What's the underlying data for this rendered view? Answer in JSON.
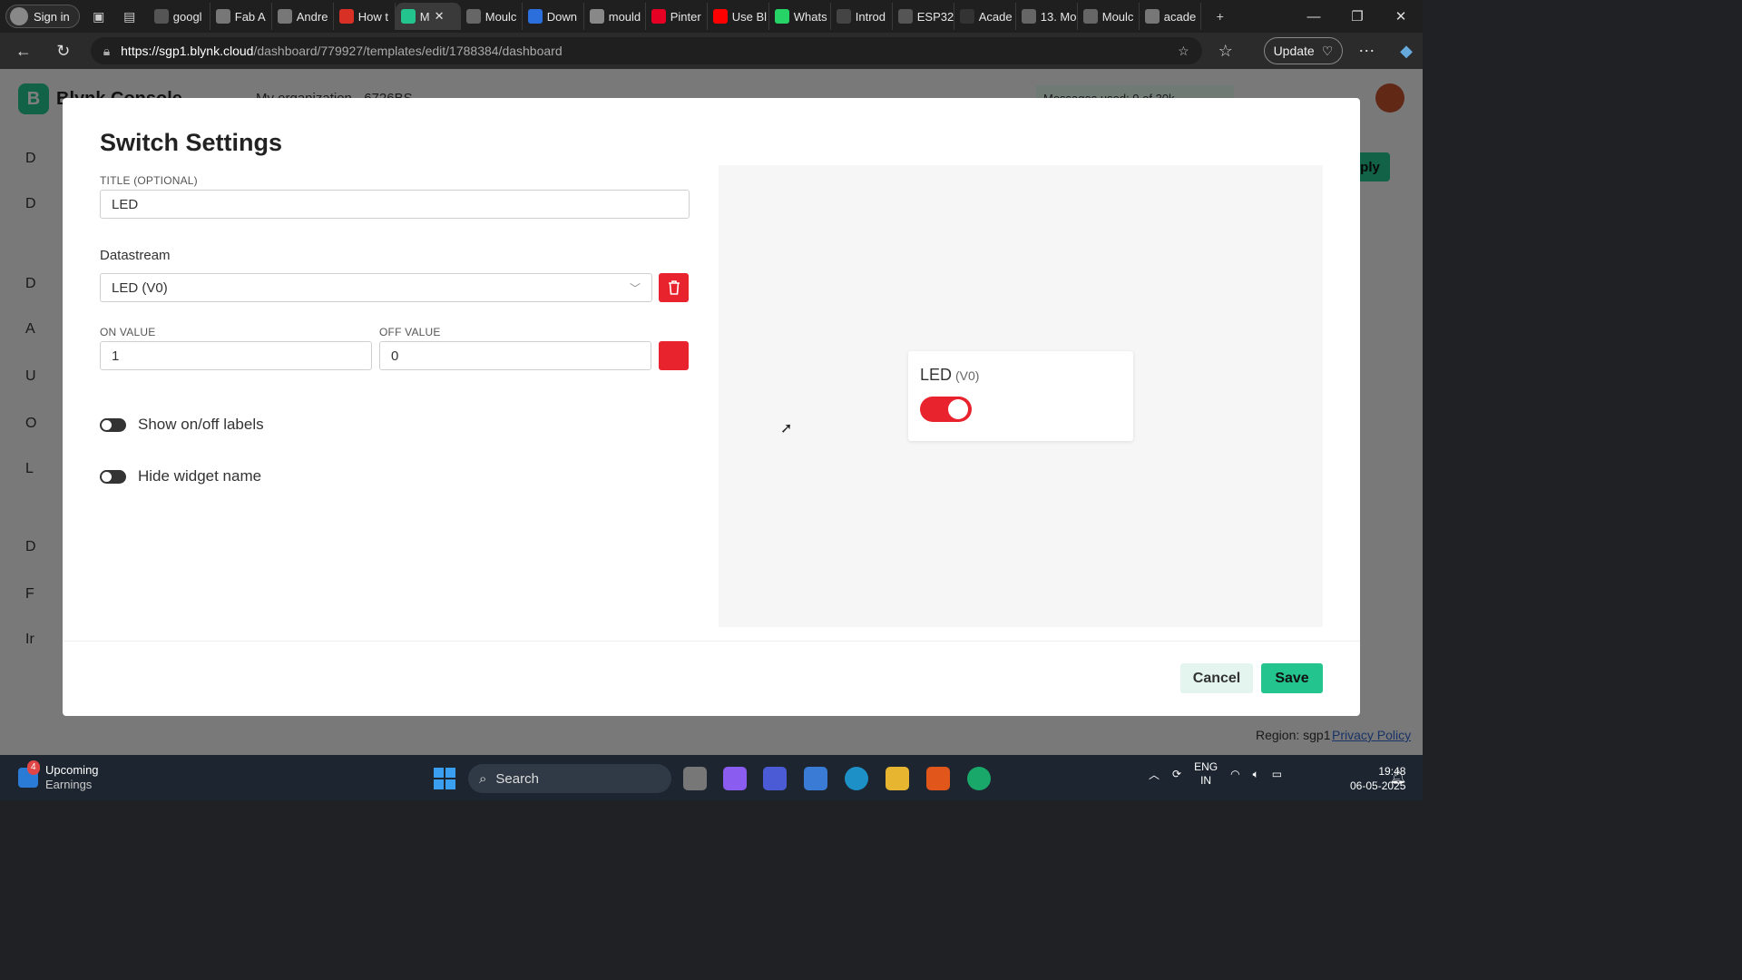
{
  "browser": {
    "signin_label": "Sign in",
    "tabs": [
      {
        "label": "googl",
        "color": "#555"
      },
      {
        "label": "Fab A",
        "color": "#777"
      },
      {
        "label": "Andre",
        "color": "#777"
      },
      {
        "label": "How t",
        "color": "#d93025"
      },
      {
        "label": "M",
        "color": "#23c48e"
      },
      {
        "label": "Moulc",
        "color": "#666"
      },
      {
        "label": "Down",
        "color": "#2a6fdb"
      },
      {
        "label": "mould",
        "color": "#888"
      },
      {
        "label": "Pinter",
        "color": "#e60023"
      },
      {
        "label": "Use Bl",
        "color": "#ff0000"
      },
      {
        "label": "Whats",
        "color": "#25d366"
      },
      {
        "label": "Introd",
        "color": "#444"
      },
      {
        "label": "ESP32",
        "color": "#555"
      },
      {
        "label": "Acade",
        "color": "#333"
      },
      {
        "label": "13. Mo",
        "color": "#666"
      },
      {
        "label": "Moulc",
        "color": "#666"
      },
      {
        "label": "acade",
        "color": "#777"
      }
    ],
    "url_host": "https://sgp1.blynk.cloud",
    "url_path": "/dashboard/779927/templates/edit/1788384/dashboard",
    "update_label": "Update"
  },
  "background_page": {
    "brand": "Blynk.Console",
    "org": "My organization - 6726BS",
    "messages": "Messages used: 0 of 30k",
    "apply_label": "ply",
    "side_items": [
      "D",
      "D",
      "D",
      "A",
      "U",
      "O",
      "L",
      "D",
      "F",
      "Ir"
    ],
    "region": "Region: sgp1",
    "privacy": "Privacy Policy"
  },
  "modal": {
    "title": "Switch Settings",
    "title_label": "TITLE (OPTIONAL)",
    "title_value": "LED",
    "datastream_label": "Datastream",
    "datastream_value": "LED (V0)",
    "on_label": "ON VALUE",
    "on_value": "1",
    "off_label": "OFF VALUE",
    "off_value": "0",
    "show_labels": "Show on/off labels",
    "hide_name": "Hide widget name",
    "preview": {
      "name": "LED",
      "pin": "(V0)",
      "switch_on": true
    },
    "cancel_label": "Cancel",
    "save_label": "Save",
    "accent": "#23c48e",
    "danger": "#e8232e"
  },
  "taskbar": {
    "weather_badge": "4",
    "weather_line1": "Upcoming",
    "weather_line2": "Earnings",
    "search_label": "Search",
    "lang1": "ENG",
    "lang2": "IN",
    "time": "19:48",
    "date": "06-05-2025"
  }
}
